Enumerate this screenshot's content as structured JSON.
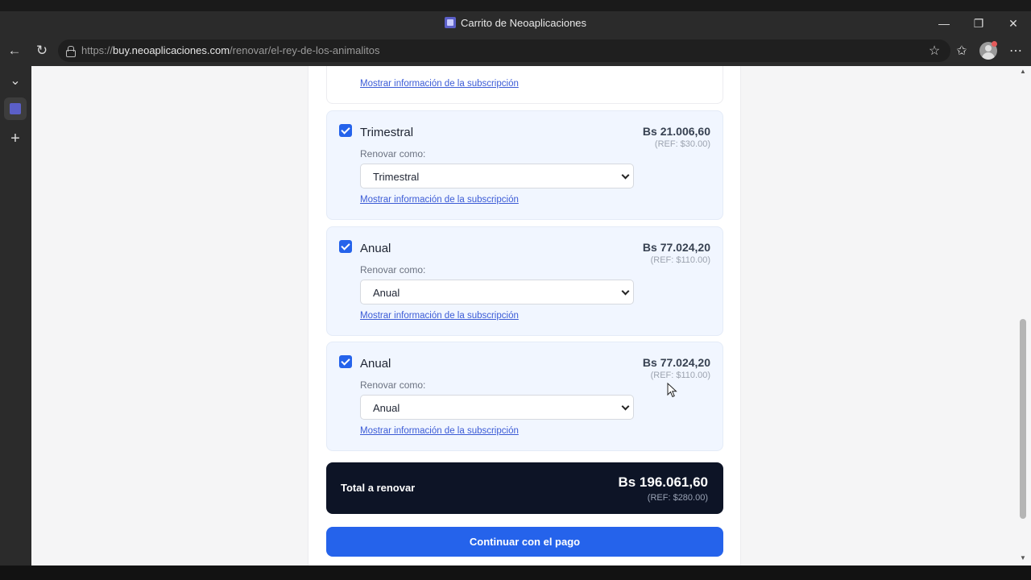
{
  "browser": {
    "window_title": "Carrito de Neoaplicaciones",
    "url_scheme": "https://",
    "url_domain": "buy.neoaplicaciones.com",
    "url_path": "/renovar/el-rey-de-los-animalitos",
    "icons": [
      "back-icon",
      "reload-icon",
      "lock-icon",
      "star-icon",
      "favorites-icon",
      "profile-avatar",
      "more-icon",
      "minimize-icon",
      "restore-icon",
      "close-icon"
    ]
  },
  "sidebar": {
    "icons": [
      "chevron-down-icon",
      "tab-favicon",
      "add-icon"
    ]
  },
  "page": {
    "top_card": {
      "link": "Mostrar información de la subscripción"
    },
    "items": [
      {
        "name": "Trimestral",
        "renew_label": "Renovar como:",
        "selected": "Trimestral",
        "link": "Mostrar información de la subscripción",
        "price": "Bs 21.006,60",
        "ref": "(REF: $30.00)",
        "checked": true
      },
      {
        "name": "Anual",
        "renew_label": "Renovar como:",
        "selected": "Anual",
        "link": "Mostrar información de la subscripción",
        "price": "Bs 77.024,20",
        "ref": "(REF: $110.00)",
        "checked": true
      },
      {
        "name": "Anual",
        "renew_label": "Renovar como:",
        "selected": "Anual",
        "link": "Mostrar información de la subscripción",
        "price": "Bs 77.024,20",
        "ref": "(REF: $110.00)",
        "checked": true
      }
    ],
    "total": {
      "label": "Total a renovar",
      "value": "Bs 196.061,60",
      "ref": "(REF: $280.00)"
    },
    "pay_button": "Continuar con el pago"
  },
  "colors": {
    "accent": "#2563eb",
    "total_bg": "#0d1426",
    "card_bg": "#f1f6ff"
  }
}
